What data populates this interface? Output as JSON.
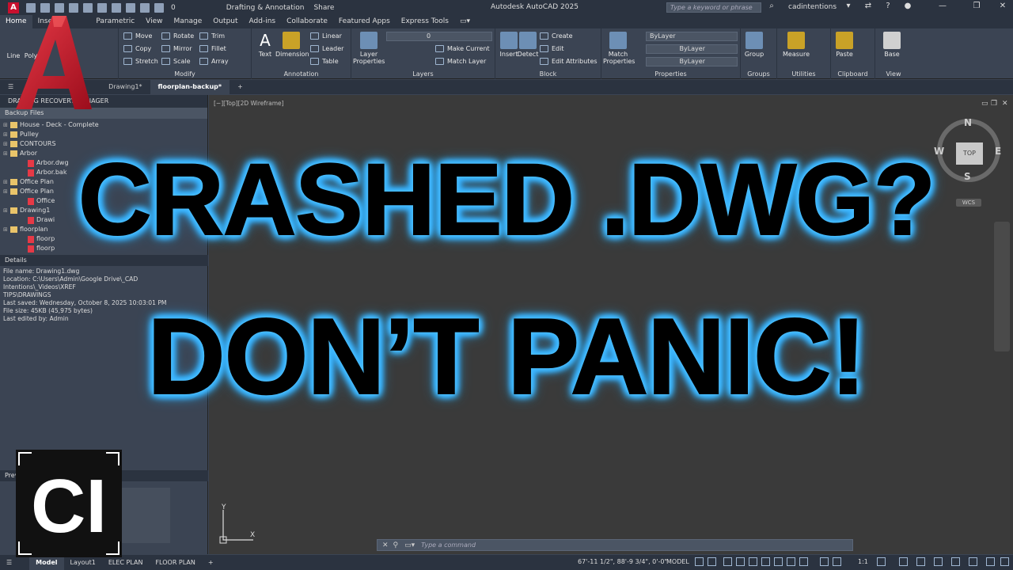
{
  "app": {
    "title": "Autodesk AutoCAD 2025",
    "app_button": "A",
    "workspace": "Drafting & Annotation",
    "share": "Share",
    "layer_qat": "0",
    "search_placeholder": "Type a keyword or phrase",
    "user": "cadintentions"
  },
  "ribbon_tabs": [
    "Home",
    "Insert",
    "Parametric",
    "View",
    "Manage",
    "Output",
    "Add-ins",
    "Collaborate",
    "Featured Apps",
    "Express Tools"
  ],
  "ribbon": {
    "draw": {
      "line": "Line",
      "polyline": "Poly",
      "circle": "le"
    },
    "modify": {
      "title": "Modify",
      "move": "Move",
      "rotate": "Rotate",
      "trim": "Trim",
      "copy": "Copy",
      "mirror": "Mirror",
      "fillet": "Fillet",
      "stretch": "Stretch",
      "scale": "Scale",
      "array": "Array"
    },
    "annotation": {
      "title": "Annotation",
      "text": "Text",
      "dimension": "Dimension",
      "linear": "Linear",
      "leader": "Leader",
      "table": "Table"
    },
    "layers": {
      "title": "Layers",
      "layer_properties": "Layer Properties",
      "layer_value": "0",
      "make_current": "Make Current",
      "match_layer": "Match Layer"
    },
    "block": {
      "title": "Block",
      "insert": "Insert",
      "detect": "Detect",
      "create": "Create",
      "edit": "Edit",
      "edit_attributes": "Edit Attributes"
    },
    "properties": {
      "title": "Properties",
      "match_properties": "Match Properties",
      "color": "ByLayer",
      "linetype": "ByLayer",
      "lineweight": "ByLayer"
    },
    "groups": {
      "title": "Groups",
      "group": "Group"
    },
    "utilities": {
      "title": "Utilities",
      "measure": "Measure"
    },
    "clipboard": {
      "title": "Clipboard",
      "paste": "Paste"
    },
    "view": {
      "title": "View",
      "base": "Base"
    }
  },
  "file_tabs": [
    "Drawing1*",
    "floorplan-backup*"
  ],
  "palette": {
    "title": "DRAWING RECOVERY MANAGER",
    "backup_header": "Backup Files",
    "tree": [
      {
        "label": "House - Deck - Complete",
        "type": "folder"
      },
      {
        "label": "Pulley",
        "type": "folder"
      },
      {
        "label": "CONTOURS",
        "type": "folder"
      },
      {
        "label": "Arbor",
        "type": "folder"
      },
      {
        "label": "Arbor.dwg",
        "type": "file"
      },
      {
        "label": "Arbor.bak",
        "type": "file"
      },
      {
        "label": "Office Plan",
        "type": "folder"
      },
      {
        "label": "Office Plan",
        "type": "folder"
      },
      {
        "label": "Office",
        "type": "file"
      },
      {
        "label": "Drawing1",
        "type": "folder"
      },
      {
        "label": "Drawi",
        "type": "file"
      },
      {
        "label": "floorplan",
        "type": "folder"
      },
      {
        "label": "floorp",
        "type": "file"
      },
      {
        "label": "floorp",
        "type": "file"
      }
    ],
    "details_title": "Details",
    "details": [
      "File name: Drawing1.dwg",
      "Location: C:\\Users\\Admin\\Google Drive\\_CAD Intentions\\_Videos\\XREF",
      "TIPS\\DRAWINGS",
      "Last saved: Wednesday, October 8, 2025  10:03:01 PM",
      "File size: 45KB (45,975 bytes)",
      "Last edited by: Admin"
    ],
    "preview_title": "Preview"
  },
  "canvas": {
    "view_label": "[−][Top][2D Wireframe]",
    "viewcube": {
      "n": "N",
      "s": "S",
      "e": "E",
      "w": "W",
      "top": "TOP",
      "wcs": "WCS"
    },
    "ucs": {
      "x": "X",
      "y": "Y"
    }
  },
  "headline": {
    "line1": "CRASHED .DWG?",
    "line2": "DON’T PANIC!"
  },
  "logo": {
    "text": "CI"
  },
  "command": {
    "placeholder": "Type a command"
  },
  "status": {
    "tabs": [
      "Model",
      "Layout1",
      "ELEC PLAN",
      "FLOOR PLAN"
    ],
    "coords": "67'-11 1/2\", 88'-9 3/4\", 0'-0\"",
    "model": "MODEL",
    "scale": "1:1"
  },
  "colors": {
    "accent_glow": "#3fb7ff",
    "autocad_red": "#c8102e"
  }
}
